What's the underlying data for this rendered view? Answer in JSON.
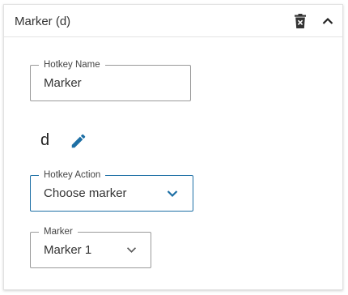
{
  "panel": {
    "title": "Marker (d)",
    "delete_icon": "delete-icon",
    "collapse_icon": "chevron-up-icon"
  },
  "hotkey_name": {
    "label": "Hotkey Name",
    "value": "Marker"
  },
  "hotkey_key": {
    "value": "d",
    "edit_icon": "pencil-icon"
  },
  "hotkey_action": {
    "label": "Hotkey Action",
    "value": "Choose marker"
  },
  "marker": {
    "label": "Marker",
    "value": "Marker 1"
  },
  "colors": {
    "accent": "#1d6fa5",
    "border": "#9a9a9a",
    "text": "#333333"
  }
}
